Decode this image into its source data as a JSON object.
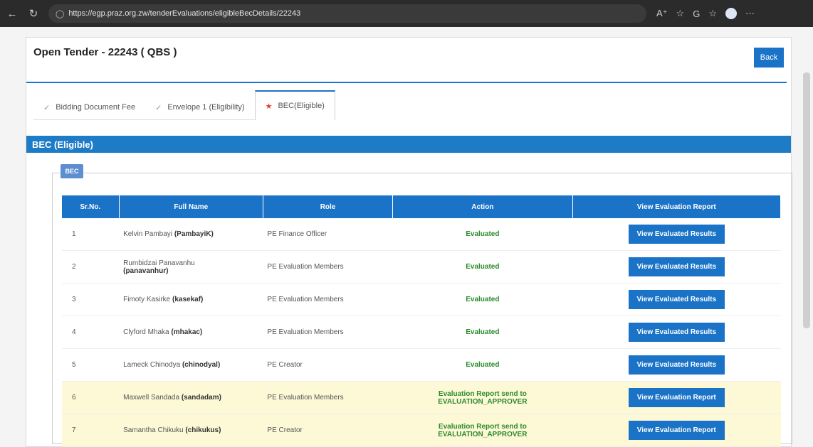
{
  "browser": {
    "url": "https://egp.praz.org.zw/tenderEvaluations/eligibleBecDetails/22243"
  },
  "page": {
    "title": "Open Tender - 22243 ( QBS )",
    "back_label": "Back"
  },
  "tabs": [
    {
      "label": "Bidding Document Fee"
    },
    {
      "label": "Envelope 1 (Eligibility)"
    },
    {
      "label": "BEC(Eligible)"
    }
  ],
  "section": {
    "header": "BEC (Eligible)",
    "legend": "BEC"
  },
  "table": {
    "headers": [
      "Sr.No.",
      "Full Name",
      "Role",
      "Action",
      "View Evaluation Report"
    ],
    "rows": [
      {
        "no": "1",
        "name": "Kelvin Pambayi",
        "user": "(PambayiK)",
        "role": "PE Finance Officer",
        "action": "Evaluated",
        "action2": "",
        "button": "View Evaluated Results",
        "highlight": false
      },
      {
        "no": "2",
        "name": "Rumbidzai Panavanhu",
        "user": "(panavanhur)",
        "role": "PE Evaluation Members",
        "action": "Evaluated",
        "action2": "",
        "button": "View Evaluated Results",
        "highlight": false
      },
      {
        "no": "3",
        "name": "Fimoty Kasirke",
        "user": "(kasekaf)",
        "role": "PE Evaluation Members",
        "action": "Evaluated",
        "action2": "",
        "button": "View Evaluated Results",
        "highlight": false
      },
      {
        "no": "4",
        "name": "Clyford Mhaka",
        "user": "(mhakac)",
        "role": "PE Evaluation Members",
        "action": "Evaluated",
        "action2": "",
        "button": "View Evaluated Results",
        "highlight": false
      },
      {
        "no": "5",
        "name": "Lameck Chinodya",
        "user": "(chinodyal)",
        "role": "PE Creator",
        "action": "Evaluated",
        "action2": "",
        "button": "View Evaluated Results",
        "highlight": false
      },
      {
        "no": "6",
        "name": "Maxwell Sandada",
        "user": "(sandadam)",
        "role": "PE Evaluation Members",
        "action": "Evaluation Report send to",
        "action2": "EVALUATION_APPROVER",
        "button": "View Evaluation Report",
        "highlight": true
      },
      {
        "no": "7",
        "name": "Samantha Chikuku",
        "user": "(chikukus)",
        "role": "PE Creator",
        "action": "Evaluation Report send to",
        "action2": "EVALUATION_APPROVER",
        "button": "View Evaluation Report",
        "highlight": true
      }
    ]
  }
}
